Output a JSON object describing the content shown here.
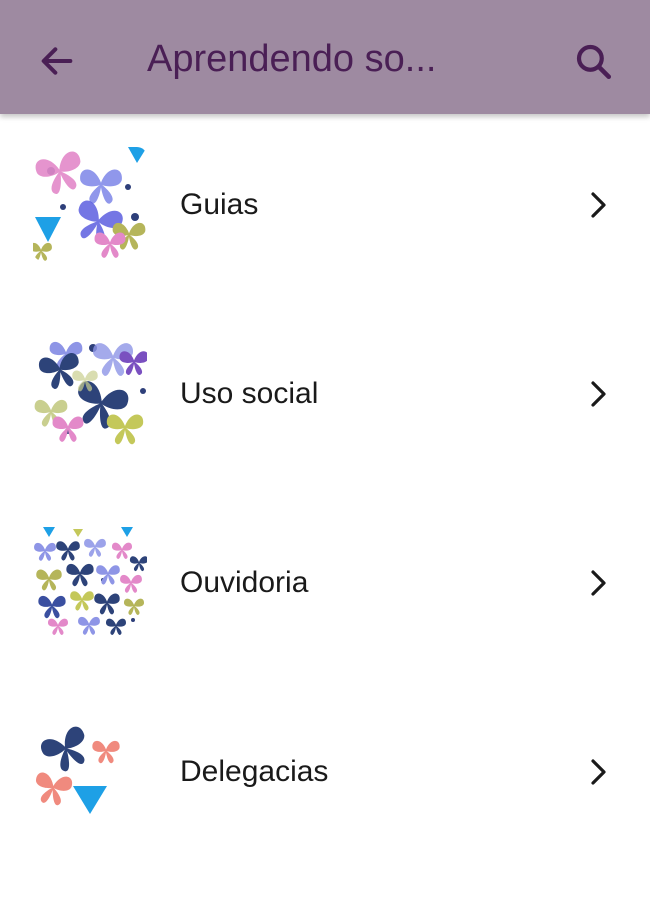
{
  "appbar": {
    "title": "Aprendendo so...",
    "color": "#9e8aa1",
    "title_color": "#4a1f55",
    "back_icon": "arrow-left-icon",
    "search_icon": "search-icon"
  },
  "items": [
    {
      "label": "Guias",
      "icon": "butterfly-pattern-thumbnail"
    },
    {
      "label": "Uso social",
      "icon": "butterfly-pattern-thumbnail"
    },
    {
      "label": "Ouvidoria",
      "icon": "butterfly-pattern-thumbnail"
    },
    {
      "label": "Delegacias",
      "icon": "butterfly-pattern-thumbnail"
    }
  ],
  "chevron_icon": "chevron-right-icon"
}
